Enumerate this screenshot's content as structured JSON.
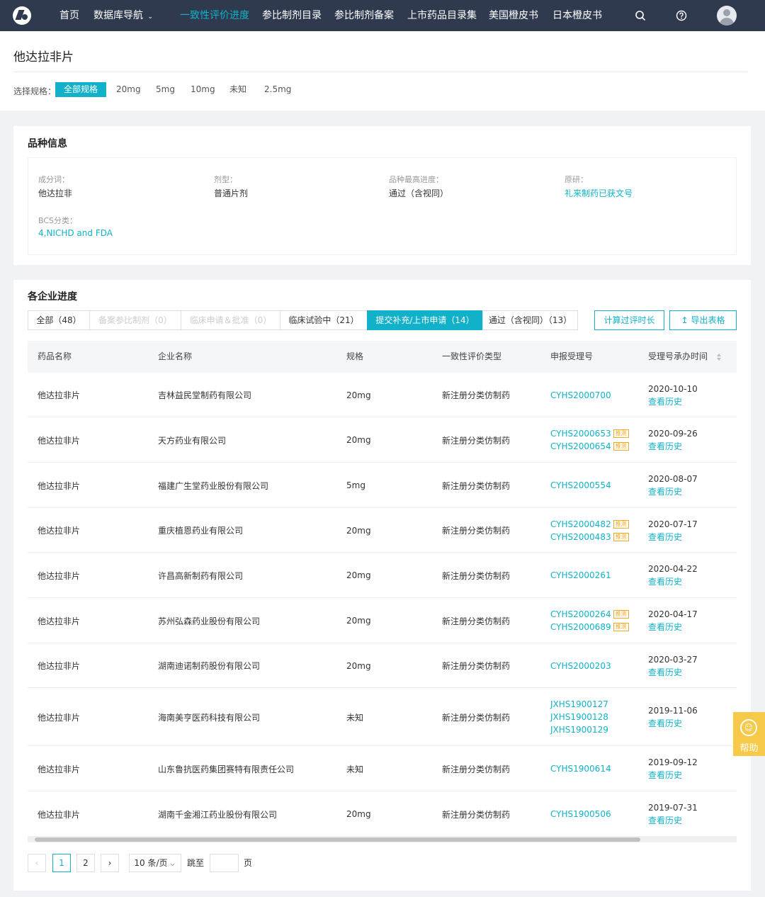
{
  "nav": {
    "items": [
      {
        "label": "首页",
        "active": false
      },
      {
        "label": "数据库导航",
        "active": false,
        "dropdown": true
      },
      {
        "label": "一致性评价进度",
        "active": true
      },
      {
        "label": "参比制剂目录",
        "active": false
      },
      {
        "label": "参比制剂备案",
        "active": false
      },
      {
        "label": "上市药品目录集",
        "active": false
      },
      {
        "label": "美国橙皮书",
        "active": false
      },
      {
        "label": "日本橙皮书",
        "active": false
      }
    ],
    "icons": [
      "search-icon",
      "question-icon",
      "avatar"
    ]
  },
  "header": {
    "title": "他达拉非片",
    "spec_label": "选择规格：",
    "specs": [
      "全部规格",
      "20mg",
      "5mg",
      "10mg",
      "未知",
      "2.5mg"
    ],
    "active_spec": "全部规格"
  },
  "variety": {
    "title": "品种信息",
    "ingredient_label": "成分词：",
    "ingredient_value": "他达拉非",
    "form_label": "剂型：",
    "form_value": "普通片剂",
    "progress_label": "品种最高进度：",
    "progress_value": "通过（含视同）",
    "original_label": "原研：",
    "original_value": "礼来制药已获文号",
    "bcs_label": "BCS分类：",
    "bcs_value": "4,NICHD and FDA"
  },
  "progress": {
    "title": "各企业进度",
    "tabs": [
      {
        "label": "全部（48）",
        "state": "normal"
      },
      {
        "label": "备案参比制剂（0）",
        "state": "disabled"
      },
      {
        "label": "临床申请＆批准（0）",
        "state": "disabled"
      },
      {
        "label": "临床试验中（21）",
        "state": "normal"
      },
      {
        "label": "提交补充/上市申请（14）",
        "state": "active"
      },
      {
        "label": "通过（含视同）（13）",
        "state": "normal"
      }
    ],
    "calc_button": "计算过评时长",
    "export_button": "导出表格",
    "columns": [
      "药品名称",
      "企业名称",
      "规格",
      "一致性评价类型",
      "申报受理号",
      "受理号承办时间"
    ],
    "rows": [
      {
        "drug": "他达拉非片",
        "company": "吉林益民堂制药有限公司",
        "spec": "20mg",
        "type": "新注册分类仿制药",
        "codes": [
          {
            "code": "CYHS2000700",
            "tag": ""
          }
        ],
        "date": "2020-10-10",
        "history": "查看历史"
      },
      {
        "drug": "他达拉非片",
        "company": "天方药业有限公司",
        "spec": "20mg",
        "type": "新注册分类仿制药",
        "codes": [
          {
            "code": "CYHS2000653",
            "tag": "推测"
          },
          {
            "code": "CYHS2000654",
            "tag": "推测"
          }
        ],
        "date": "2020-09-26",
        "history": "查看历史"
      },
      {
        "drug": "他达拉非片",
        "company": "福建广生堂药业股份有限公司",
        "spec": "5mg",
        "type": "新注册分类仿制药",
        "codes": [
          {
            "code": "CYHS2000554",
            "tag": ""
          }
        ],
        "date": "2020-08-07",
        "history": "查看历史"
      },
      {
        "drug": "他达拉非片",
        "company": "重庆植恩药业有限公司",
        "spec": "20mg",
        "type": "新注册分类仿制药",
        "codes": [
          {
            "code": "CYHS2000482",
            "tag": "推测"
          },
          {
            "code": "CYHS2000483",
            "tag": "推测"
          }
        ],
        "date": "2020-07-17",
        "history": "查看历史"
      },
      {
        "drug": "他达拉非片",
        "company": "许昌高新制药有限公司",
        "spec": "20mg",
        "type": "新注册分类仿制药",
        "codes": [
          {
            "code": "CYHS2000261",
            "tag": ""
          }
        ],
        "date": "2020-04-22",
        "history": "查看历史"
      },
      {
        "drug": "他达拉非片",
        "company": "苏州弘森药业股份有限公司",
        "spec": "20mg",
        "type": "新注册分类仿制药",
        "codes": [
          {
            "code": "CYHS2000264",
            "tag": "推测"
          },
          {
            "code": "CYHS2000689",
            "tag": "推测"
          }
        ],
        "date": "2020-04-17",
        "history": "查看历史"
      },
      {
        "drug": "他达拉非片",
        "company": "湖南迪诺制药股份有限公司",
        "spec": "20mg",
        "type": "新注册分类仿制药",
        "codes": [
          {
            "code": "CYHS2000203",
            "tag": ""
          }
        ],
        "date": "2020-03-27",
        "history": "查看历史"
      },
      {
        "drug": "他达拉非片",
        "company": "海南美亨医药科技有限公司",
        "spec": "未知",
        "type": "新注册分类仿制药",
        "codes": [
          {
            "code": "JXHS1900127",
            "tag": ""
          },
          {
            "code": "JXHS1900128",
            "tag": ""
          },
          {
            "code": "JXHS1900129",
            "tag": ""
          }
        ],
        "date": "2019-11-06",
        "history": "查看历史"
      },
      {
        "drug": "他达拉非片",
        "company": "山东鲁抗医药集团赛特有限责任公司",
        "spec": "未知",
        "type": "新注册分类仿制药",
        "codes": [
          {
            "code": "CYHS1900614",
            "tag": ""
          }
        ],
        "date": "2019-09-12",
        "history": "查看历史"
      },
      {
        "drug": "他达拉非片",
        "company": "湖南千金湘江药业股份有限公司",
        "spec": "20mg",
        "type": "新注册分类仿制药",
        "codes": [
          {
            "code": "CYHS1900506",
            "tag": ""
          }
        ],
        "date": "2019-07-31",
        "history": "查看历史"
      }
    ]
  },
  "pagination": {
    "pages": [
      "1",
      "2"
    ],
    "current": "1",
    "page_size": "10 条/页",
    "goto_label": "跳至",
    "goto_suffix": "页"
  },
  "help": {
    "label": "帮助"
  },
  "colors": {
    "accent": "#11b2c9",
    "nav_bg": "#2f3a4e",
    "tag": "#f5a623",
    "help_bg": "#f7c948"
  }
}
